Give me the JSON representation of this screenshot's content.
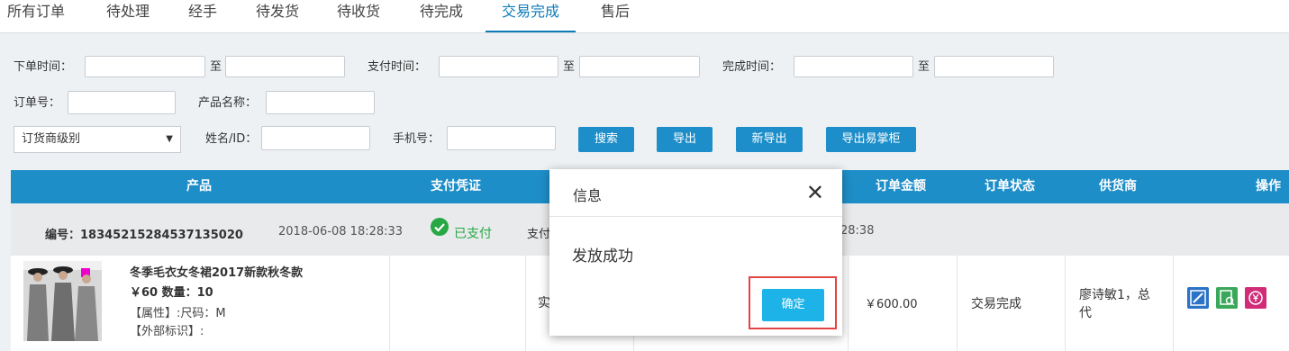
{
  "tabs": [
    "所有订单",
    "待处理",
    "经手",
    "待发货",
    "待收货",
    "待完成",
    "交易完成",
    "售后"
  ],
  "active_tab": "交易完成",
  "filters": {
    "order_time": "下单时间：",
    "pay_time": "支付时间：",
    "done_time": "完成时间：",
    "to": "至",
    "order_no": "订单号：",
    "product_name": "产品名称：",
    "level_select": "订货商级别",
    "name_id": "姓名/ID：",
    "phone": "手机号："
  },
  "buttons": {
    "search": "搜索",
    "export": "导出",
    "new_export": "新导出",
    "export_yzg": "导出易掌柜"
  },
  "table_headers": {
    "product": "产品",
    "pay_proof": "支付凭证",
    "amount": "订单金额",
    "status": "订单状态",
    "supplier": "供货商",
    "ops": "操作"
  },
  "order": {
    "number": "编号：18345215284537135020",
    "created": "2018-06-08 18:28:33",
    "paid": "已支付",
    "pay_prefix": "支付",
    "time_suffix": "28:38",
    "product_title": "冬季毛衣女冬裙2017新款秋冬款",
    "price_qty": "￥60 数量：10",
    "attr": "【属性】:尺码：M",
    "ext_id": "【外部标识】:",
    "partial_col": "实",
    "amount": "￥600.00",
    "status": "交易完成",
    "supplier_line1": "廖诗敏1，总",
    "supplier_line2": "代"
  },
  "dialog": {
    "title": "信息",
    "message": "发放成功",
    "ok": "确定"
  }
}
